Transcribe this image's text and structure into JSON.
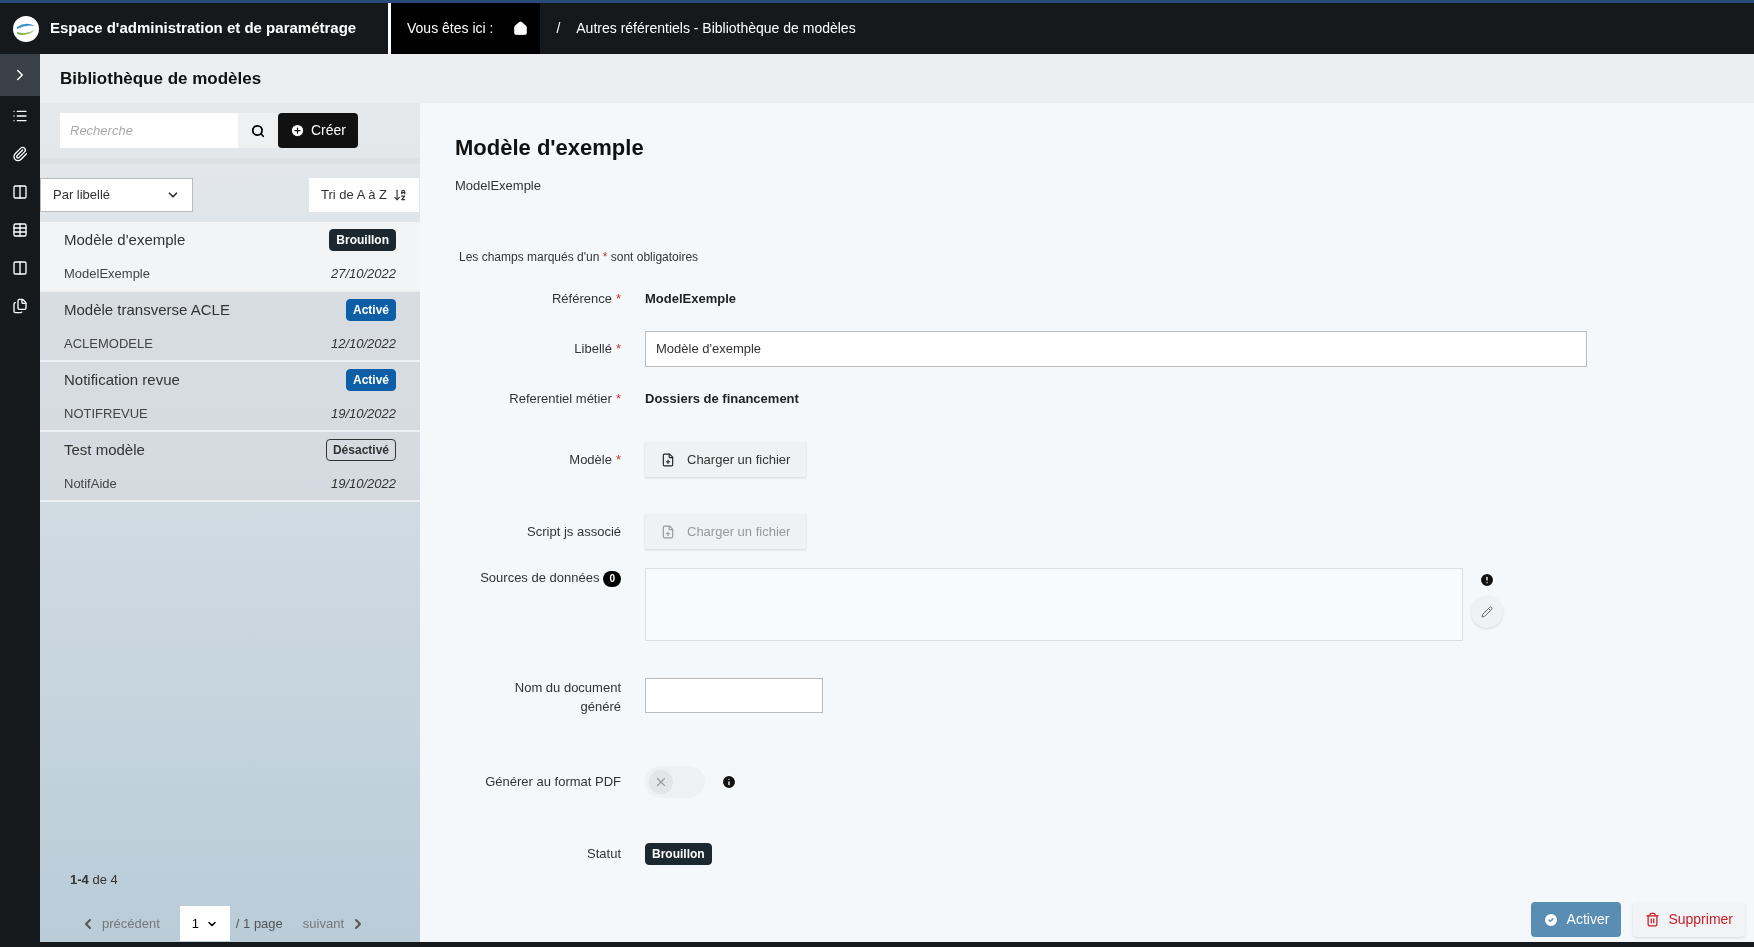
{
  "header": {
    "title": "Espace d'administration et de paramétrage",
    "breadcrumb_label": "Vous êtes ici :",
    "separator": "/",
    "breadcrumb_path": "Autres référentiels - Bibliothèque de modèles"
  },
  "page_title": "Bibliothèque de modèles",
  "list": {
    "search_placeholder": "Recherche",
    "create_button": "Créer",
    "sort_field": "Par libellé",
    "sort_order": "Tri de A à Z",
    "items": [
      {
        "title": "Modèle d'exemple",
        "code": "ModelExemple",
        "date": "27/10/2022",
        "status_label": "Brouillon",
        "kind": "draft",
        "selected": true
      },
      {
        "title": "Modèle transverse ACLE",
        "code": "ACLEMODELE",
        "date": "12/10/2022",
        "status_label": "Activé",
        "kind": "active",
        "selected": false
      },
      {
        "title": "Notification revue",
        "code": "NOTIFREVUE",
        "date": "19/10/2022",
        "status_label": "Activé",
        "kind": "active",
        "selected": false
      },
      {
        "title": "Test modèle",
        "code": "NotifAide",
        "date": "19/10/2022",
        "status_label": "Désactivé",
        "kind": "inactive",
        "selected": false
      }
    ],
    "count": "**1-4** de 4",
    "pagination": {
      "previous": "précédent",
      "page": "1",
      "total": "/ 1 page",
      "next": "suivant"
    }
  },
  "detail": {
    "title": "Modèle d'exemple",
    "subtitle": "ModelExemple",
    "required_note": {
      "before": "Les champs marqués d'un",
      "mark": "*",
      "after": "sont obligatoires"
    },
    "fields": [
      {
        "kind": "text",
        "label": "Référence",
        "required_mark": "*",
        "value": "ModelExemple"
      },
      {
        "kind": "input",
        "label": "Libellé",
        "required_mark": "*",
        "value": "Modèle d'exemple"
      },
      {
        "kind": "text",
        "label": "Referentiel métier",
        "required_mark": "*",
        "value": "Dossiers de financement"
      },
      {
        "kind": "file",
        "label": "Modèle",
        "required_mark": "*",
        "button": "Charger un fichier",
        "disabled": false
      },
      {
        "kind": "file",
        "label": "Script js associé",
        "button": "Charger un fichier",
        "disabled": true
      },
      {
        "kind": "textarea",
        "label": "Sources de données",
        "count": "0"
      },
      {
        "kind": "short_input",
        "label": "Nom du document généré"
      },
      {
        "kind": "toggle",
        "label": "Générer au format PDF",
        "on": false
      },
      {
        "kind": "status",
        "label": "Statut",
        "badge": {
          "label": "Brouillon",
          "kind": "draft"
        }
      }
    ],
    "actions": [
      {
        "label": "Activer",
        "kind": "primary"
      },
      {
        "label": "Supprimer",
        "kind": "danger"
      }
    ]
  }
}
